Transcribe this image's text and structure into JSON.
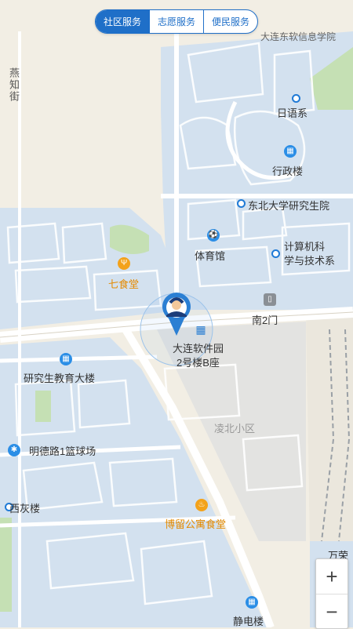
{
  "tabs": [
    "社区服务",
    "志愿服务",
    "便民服务"
  ],
  "active_tab": "社区服务",
  "labels": {
    "yanzhi_street": "燕知街",
    "top_cut": "大连东软信息学院",
    "japanese_dept": "日语系",
    "admin_building": "行政楼",
    "grad_school": "东北大学研究生院",
    "gym": "体育馆",
    "cs_dept_line1": "计算机科",
    "cs_dept_line2": "学与技术系",
    "canteen7": "七食堂",
    "south_gate2": "南2门",
    "softpark_line1": "大连软件园",
    "softpark_line2": "2号楼B座",
    "grad_edu_building": "研究生教育大楼",
    "lingbei": "凌北小区",
    "mingde_court": "明德路1篮球场",
    "xihui_building": "西灰楼",
    "boliu_canteen": "博留公寓食堂",
    "jingdian_building": "静电楼",
    "wanke_cut": "万荣"
  },
  "zoom": {
    "in": "+",
    "out": "−"
  },
  "colors": {
    "accent": "#1f6fc8",
    "block": "#d3e1ef",
    "road": "#ffffff",
    "ground": "#f2eee4",
    "orange": "#e48a00"
  }
}
